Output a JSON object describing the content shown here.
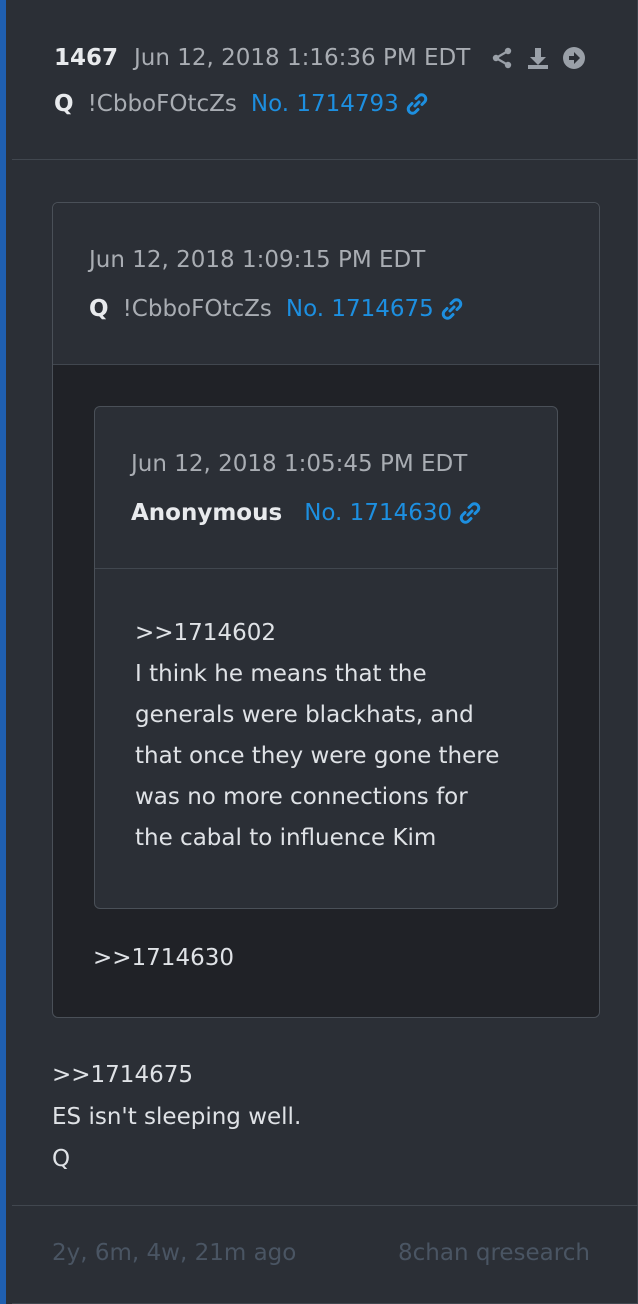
{
  "post": {
    "number": "1467",
    "date": "Jun 12, 2018 1:16:36 PM EDT",
    "author": "Q",
    "tripcode": "!CbboFOtcZs",
    "post_link": "No. 1714793",
    "icons": [
      "share-icon",
      "download-icon",
      "arrow-right-icon",
      "link-icon"
    ],
    "body": [
      ">>1714675",
      "ES isn't sleeping well.",
      "Q"
    ]
  },
  "quote1": {
    "date": "Jun 12, 2018 1:09:15 PM EDT",
    "author": "Q",
    "tripcode": "!CbboFOtcZs",
    "post_link": "No. 1714675",
    "body": ">>1714630"
  },
  "quote2": {
    "date": "Jun 12, 2018 1:05:45 PM EDT",
    "author": "Anonymous",
    "post_link": "No. 1714630",
    "body": [
      ">>1714602",
      "I think he means that the",
      "generals were blackhats, and",
      "that once they were gone there",
      "was no more connections for",
      "the cabal to influence Kim"
    ]
  },
  "footer": {
    "age": "2y, 6m, 4w, 21m ago",
    "source": "8chan qresearch"
  },
  "colors": {
    "accent": "#1d8fe0",
    "left_bar": "#1f5fb0",
    "background": "#2b2f36"
  }
}
